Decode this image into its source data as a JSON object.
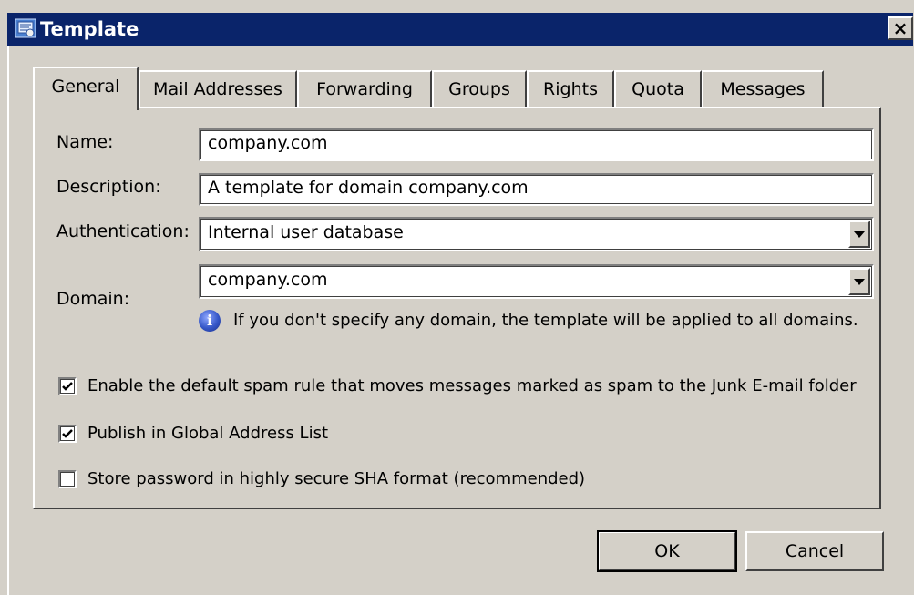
{
  "window": {
    "title": "Template",
    "close_label": "×"
  },
  "tabs": [
    {
      "label": "General",
      "active": true
    },
    {
      "label": "Mail Addresses",
      "active": false
    },
    {
      "label": "Forwarding",
      "active": false
    },
    {
      "label": "Groups",
      "active": false
    },
    {
      "label": "Rights",
      "active": false
    },
    {
      "label": "Quota",
      "active": false
    },
    {
      "label": "Messages",
      "active": false
    }
  ],
  "form": {
    "name_label": "Name:",
    "name_value": "company.com",
    "description_label": "Description:",
    "description_value": "A template for domain company.com",
    "authentication_label": "Authentication:",
    "authentication_value": "Internal user database",
    "domain_label": "Domain:",
    "domain_value": "company.com",
    "domain_info": "If you don't specify any domain, the template will be applied to all domains."
  },
  "options": {
    "spam_rule_label": "Enable the default spam rule that moves messages marked as spam to the Junk E-mail folder",
    "spam_rule_checked": true,
    "publish_gal_label": "Publish in Global Address List",
    "publish_gal_checked": true,
    "sha_label": "Store password in highly secure SHA format (recommended)",
    "sha_checked": false
  },
  "buttons": {
    "ok_label": "OK",
    "cancel_label": "Cancel"
  },
  "colors": {
    "titlebar": "#0a246a",
    "face": "#d4d0c8",
    "info_icon": "#3657c8"
  }
}
